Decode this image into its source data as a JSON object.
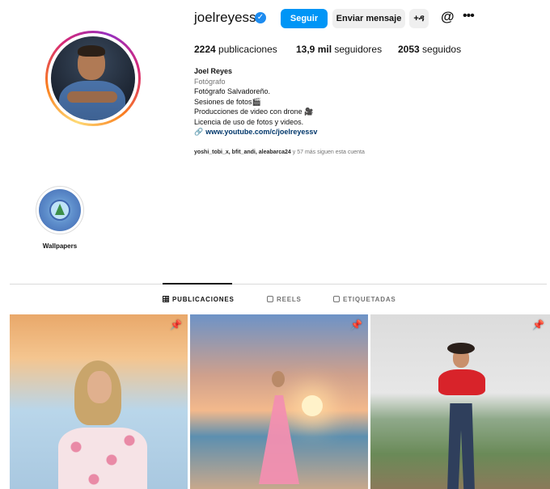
{
  "profile": {
    "username": "joelreyessv",
    "follow_label": "Seguir",
    "message_label": "Enviar mensaje",
    "add_user_icon": "+ዳ",
    "threads_icon": "@",
    "more_icon": "•••",
    "verified_icon": "✓"
  },
  "stats": {
    "posts_count": "2224",
    "posts_label": "publicaciones",
    "followers_count": "13,9 mil",
    "followers_label": "seguidores",
    "following_count": "2053",
    "following_label": "seguidos"
  },
  "bio": {
    "name": "Joel Reyes",
    "category": "Fotógrafo",
    "line1": "Fotógrafo Salvadoreño.",
    "line2": "Sesiones de fotos🎬",
    "line3": "Producciones de video con drone 🎥",
    "line4": "Licencia de uso de fotos y videos.",
    "link": "www.youtube.com/c/joelreyessv",
    "link_icon": "🔗"
  },
  "followed_by": {
    "names": "yoshi_tobi_x, bfit_andi, aleabarca24",
    "rest": " y 57 más siguen esta cuenta"
  },
  "highlights": [
    {
      "label": "Wallpapers"
    }
  ],
  "tabs": [
    {
      "label": "PUBLICACIONES",
      "active": true
    },
    {
      "label": "REELS",
      "active": false
    },
    {
      "label": "ETIQUETADAS",
      "active": false
    }
  ],
  "posts": [
    {
      "pinned": true,
      "pin_icon": "📌"
    },
    {
      "pinned": true,
      "pin_icon": "📌"
    },
    {
      "pinned": true,
      "pin_icon": "📌"
    }
  ],
  "colors": {
    "accent": "#0095f6",
    "secondary_button": "#efefef",
    "verified": "#1d8cf0"
  }
}
